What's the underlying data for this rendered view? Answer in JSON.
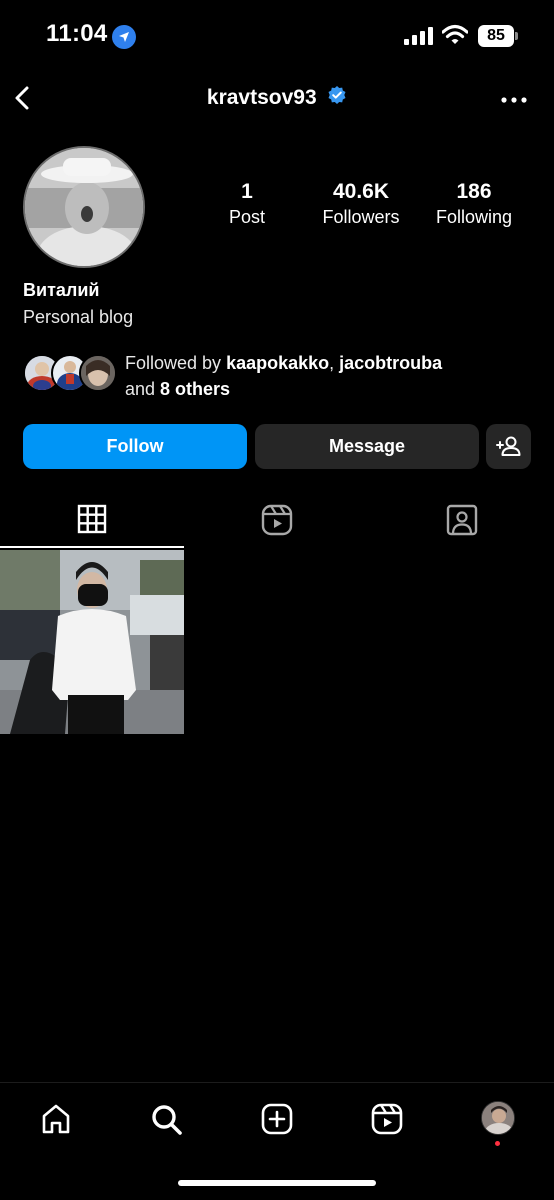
{
  "status_bar": {
    "time": "11:04",
    "battery": "85",
    "icons": [
      "location-arrow-icon",
      "signal-icon",
      "wifi-icon",
      "battery-icon"
    ]
  },
  "header": {
    "username": "kravtsov93",
    "verified": true,
    "icons": [
      "back-icon",
      "verified-icon",
      "more-icon"
    ]
  },
  "profile": {
    "name": "Виталий",
    "bio": "Personal blog",
    "stats": [
      {
        "value": "1",
        "label": "Post"
      },
      {
        "value": "40.6K",
        "label": "Followers"
      },
      {
        "value": "186",
        "label": "Following"
      }
    ],
    "followed_by": {
      "prefix": "Followed by ",
      "user1": "kaapokakko",
      "separator": ", ",
      "user2": "jacobtrouba",
      "middle": "and ",
      "others": "8 others"
    }
  },
  "actions": {
    "follow_label": "Follow",
    "message_label": "Message"
  },
  "tabs": [
    "grid-icon",
    "reels-icon",
    "tagged-icon"
  ],
  "bottom_nav": [
    "home-icon",
    "search-icon",
    "create-icon",
    "reels-icon",
    "profile-avatar"
  ],
  "colors": {
    "background": "#000000",
    "follow_button": "#0095f6",
    "secondary_button": "#262626",
    "verified_badge": "#3897f0",
    "notification_dot": "#ff3040"
  }
}
